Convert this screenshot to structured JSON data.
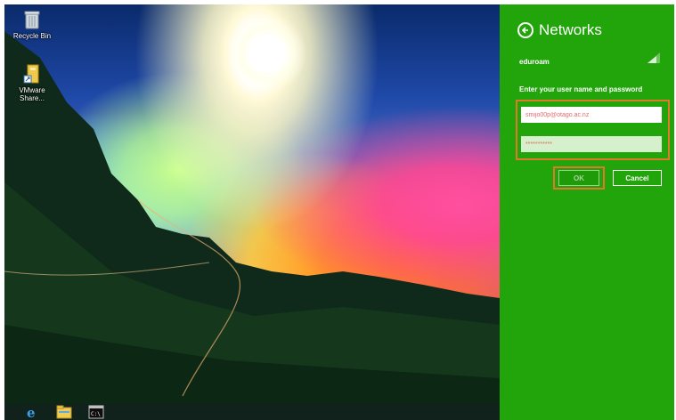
{
  "desktop": {
    "icons": [
      {
        "label": "Recycle Bin",
        "icon": "recycle-bin-icon"
      },
      {
        "label": "VMware Share...",
        "icon": "folder-shortcut-icon"
      }
    ]
  },
  "taskbar": {
    "pinned": [
      {
        "icon": "internet-explorer-icon"
      },
      {
        "icon": "file-explorer-icon"
      },
      {
        "icon": "command-prompt-icon"
      }
    ]
  },
  "network_panel": {
    "title": "Networks",
    "network_name": "eduroam",
    "prompt": "Enter your user name and password",
    "username_value": "smijo00p@otago.ac.nz",
    "password_value": "***********",
    "ok_label": "OK",
    "cancel_label": "Cancel",
    "colors": {
      "panel": "#22a50b",
      "highlight": "#e07a2a"
    }
  }
}
